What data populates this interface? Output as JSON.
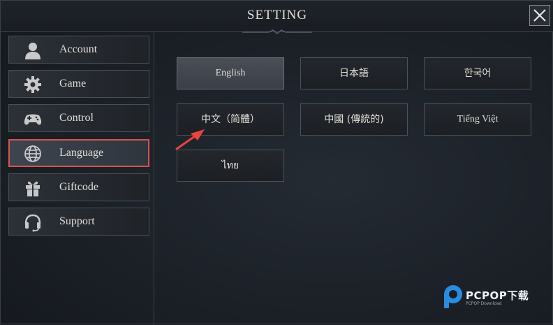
{
  "window": {
    "title": "SETTING"
  },
  "sidebar": {
    "items": [
      {
        "label": "Account",
        "icon": "user-icon"
      },
      {
        "label": "Game",
        "icon": "gear-icon"
      },
      {
        "label": "Control",
        "icon": "gamepad-icon"
      },
      {
        "label": "Language",
        "icon": "globe-icon",
        "active": true
      },
      {
        "label": "Giftcode",
        "icon": "gift-icon"
      },
      {
        "label": "Support",
        "icon": "headset-icon"
      }
    ]
  },
  "languages": [
    {
      "label": "English",
      "selected": true
    },
    {
      "label": "日本語"
    },
    {
      "label": "한국어"
    },
    {
      "label": "中文（简體）"
    },
    {
      "label": "中國 (傳統的)"
    },
    {
      "label": "Tiếng Việt"
    },
    {
      "label": "ไทย"
    }
  ],
  "watermark": {
    "text": "PCPOP下载",
    "sub": "PCPOP Download"
  },
  "colors": {
    "highlight": "#d9534f",
    "arrow": "#e8453c",
    "watermark_blue": "#2a8ce0"
  }
}
